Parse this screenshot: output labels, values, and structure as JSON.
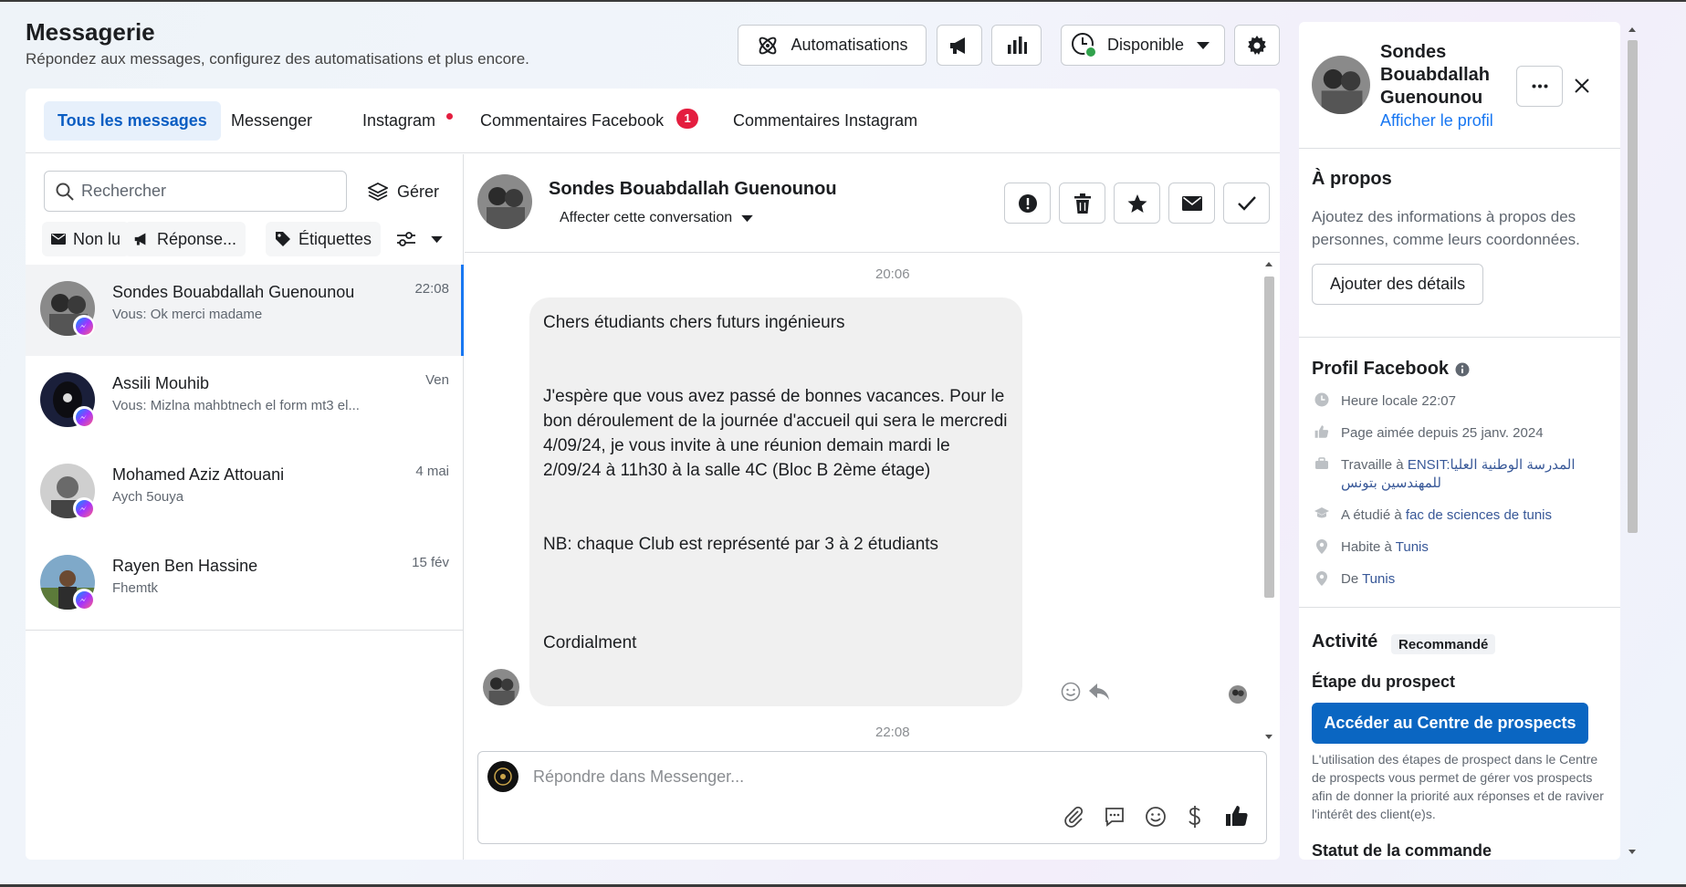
{
  "header": {
    "title": "Messagerie",
    "subtitle": "Répondez aux messages, configurez des automatisations et plus encore.",
    "automations_label": "Automatisations",
    "status_label": "Disponible"
  },
  "tabs": [
    {
      "label": "Tous les messages"
    },
    {
      "label": "Messenger"
    },
    {
      "label": "Instagram"
    },
    {
      "label": "Commentaires Facebook",
      "badge": "1"
    },
    {
      "label": "Commentaires Instagram"
    }
  ],
  "inbox": {
    "search_placeholder": "Rechercher",
    "manage_label": "Gérer",
    "filters": [
      "Non lu",
      "Réponse...",
      "Étiquettes"
    ],
    "conversations": [
      {
        "name": "Sondes Bouabdallah Guenounou",
        "preview": "Vous: Ok merci madame",
        "time": "22:08"
      },
      {
        "name": "Assili Mouhib",
        "preview": "Vous: Mizlna mahbtnech el form mt3 el...",
        "time": "Ven"
      },
      {
        "name": "Mohamed Aziz Attouani",
        "preview": "Aych 5ouya",
        "time": "4 mai"
      },
      {
        "name": "Rayen Ben Hassine",
        "preview": "Fhemtk",
        "time": "15 fév"
      }
    ]
  },
  "thread": {
    "name": "Sondes Bouabdallah Guenounou",
    "assign_label": "Affecter cette conversation",
    "time_top": "20:06",
    "time_bottom": "22:08",
    "message": {
      "p1": "Chers étudiants chers futurs ingénieurs",
      "p2": "J'espère que vous avez passé de bonnes vacances. Pour le bon déroulement de la journée d'accueil qui sera le mercredi 4/09/24, je vous invite à une réunion demain mardi le 2/09/24 à 11h30 à la salle 4C (Bloc B 2ème étage)",
      "p3": "NB: chaque Club est représenté par 3 à 2 étudiants",
      "p4": "Cordialment"
    },
    "reply_placeholder": "Répondre dans Messenger..."
  },
  "profile": {
    "name": "Sondes Bouabdallah Guenounou",
    "view_profile": "Afficher le profil",
    "about_title": "À propos",
    "about_text": "Ajoutez des informations à propos des personnes, comme leurs coordonnées.",
    "add_details": "Ajouter des détails",
    "fb_title": "Profil Facebook",
    "local_time": "Heure locale 22:07",
    "page_liked": "Page aimée depuis 25 janv. 2024",
    "works_prefix": "Travaille à ",
    "works_place": "ENSIT:المدرسة الوطنية العليا للمهندسين بتونس",
    "studied_prefix": "A étudié à ",
    "studied_place": "fac de sciences de tunis",
    "lives_prefix": "Habite à ",
    "lives_place": "Tunis",
    "from_prefix": "De ",
    "from_place": "Tunis",
    "activity_title": "Activité",
    "recommended": "Recommandé",
    "stage_title": "Étape du prospect",
    "stage_button": "Accéder au Centre de prospects",
    "stage_text": "L'utilisation des étapes de prospect dans le Centre de prospects vous permet de gérer vos prospects afin de donner la priorité aux réponses et de raviver l'intérêt des client(e)s.",
    "order_title": "Statut de la commande"
  },
  "colors": {
    "accent": "#1877f2",
    "badge": "#e41e3f",
    "online": "#31a24c"
  }
}
